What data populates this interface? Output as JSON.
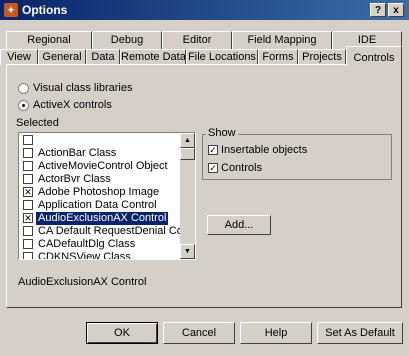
{
  "window": {
    "title": "Options",
    "close_glyph": "x",
    "help_glyph": "?"
  },
  "tabs_row1": [
    "Regional",
    "Debug",
    "Editor",
    "Field Mapping",
    "IDE"
  ],
  "tabs_row2": [
    "View",
    "General",
    "Data",
    "Remote Data",
    "File Locations",
    "Forms",
    "Projects",
    "Controls"
  ],
  "active_tab": "Controls",
  "controls": {
    "radio_visual": "Visual class libraries",
    "radio_activex": "ActiveX controls",
    "selected_label": "Selected",
    "list_items": [
      {
        "label": "",
        "checked": false,
        "selected": false
      },
      {
        "label": "ActionBar Class",
        "checked": false,
        "selected": false
      },
      {
        "label": "ActiveMovieControl Object",
        "checked": false,
        "selected": false
      },
      {
        "label": "ActorBvr Class",
        "checked": false,
        "selected": false
      },
      {
        "label": "Adobe Photoshop Image",
        "checked": true,
        "selected": false
      },
      {
        "label": "Application Data Control",
        "checked": false,
        "selected": false
      },
      {
        "label": "AudioExclusionAX Control",
        "checked": true,
        "selected": true
      },
      {
        "label": "CA Default RequestDenial Control",
        "checked": false,
        "selected": false
      },
      {
        "label": "CADefaultDlg Class",
        "checked": false,
        "selected": false
      },
      {
        "label": "CDKNSView Class",
        "checked": false,
        "selected": false
      }
    ],
    "show_group": "Show",
    "show_insertable": "Insertable objects",
    "show_controls": "Controls",
    "add_button": "Add...",
    "status_text": "AudioExclusionAX Control"
  },
  "buttons": {
    "ok": "OK",
    "cancel": "Cancel",
    "help": "Help",
    "set_default": "Set As Default"
  }
}
